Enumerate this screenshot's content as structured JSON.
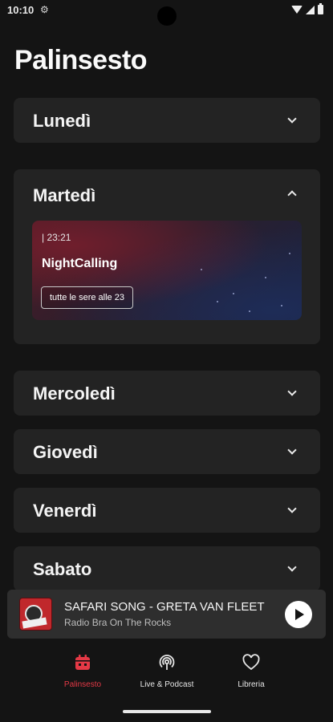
{
  "status_bar": {
    "time": "10:10",
    "gear_icon": "gear-icon"
  },
  "page": {
    "title": "Palinsesto"
  },
  "days": [
    {
      "label": "Lunedì",
      "expanded": false
    },
    {
      "label": "Martedì",
      "expanded": true
    },
    {
      "label": "Mercoledì",
      "expanded": false
    },
    {
      "label": "Giovedì",
      "expanded": false
    },
    {
      "label": "Venerdì",
      "expanded": false
    },
    {
      "label": "Sabato",
      "expanded": false
    }
  ],
  "show": {
    "time": "| 23:21",
    "name": "NightCalling",
    "tag": "tutte le sere alle 23"
  },
  "now_playing": {
    "title": "SAFARI SONG - GRETA VAN FLEET",
    "subtitle": "Radio Bra On The Rocks"
  },
  "nav": {
    "items": [
      {
        "label": "Palinsesto",
        "icon": "calendar-icon",
        "active": true
      },
      {
        "label": "Live & Podcast",
        "icon": "podcast-icon",
        "active": false
      },
      {
        "label": "Libreria",
        "icon": "heart-icon",
        "active": false
      }
    ]
  },
  "colors": {
    "accent": "#e53946",
    "background": "#141414",
    "card": "#232323"
  }
}
